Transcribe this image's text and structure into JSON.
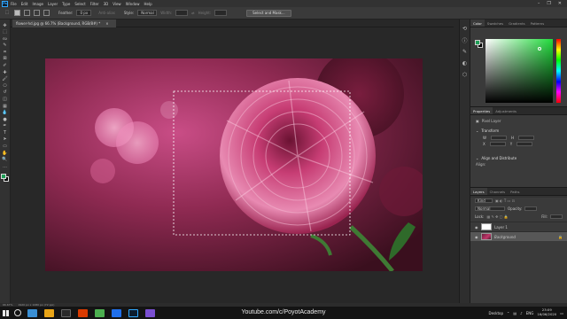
{
  "app": {
    "logo": "Ps",
    "menu": [
      "File",
      "Edit",
      "Image",
      "Layer",
      "Type",
      "Select",
      "Filter",
      "3D",
      "View",
      "Window",
      "Help"
    ],
    "window_controls": [
      "–",
      "❐",
      "✕"
    ]
  },
  "options": {
    "feather_label": "Feather:",
    "feather_value": "0 px",
    "antialias_label": "Anti-alias",
    "style_label": "Style:",
    "style_value": "Normal",
    "width_label": "Width:",
    "height_label": "Height:",
    "select_mask_button": "Select and Mask..."
  },
  "document": {
    "tab_title": "flower-hd.jpg @ 66.7% (Background, RGB/8#) *",
    "tab_close": "×"
  },
  "tools": [
    "move-icon",
    "marquee-icon",
    "lasso-icon",
    "quick-select-icon",
    "crop-icon",
    "frame-icon",
    "eyedropper-icon",
    "healing-icon",
    "brush-icon",
    "stamp-icon",
    "history-brush-icon",
    "eraser-icon",
    "gradient-icon",
    "blur-icon",
    "dodge-icon",
    "pen-icon",
    "type-icon",
    "path-select-icon",
    "shape-icon",
    "hand-icon",
    "zoom-icon",
    "more-icon"
  ],
  "tool_glyphs": [
    "✥",
    "⬚",
    "ᔓ",
    "✎",
    "⌗",
    "⊠",
    "✐",
    "✚",
    "🖌",
    "⎔",
    "↺",
    "◫",
    "▦",
    "💧",
    "●",
    "✒",
    "T",
    "➤",
    "▭",
    "✋",
    "🔍",
    "…"
  ],
  "colors": {
    "foreground": "#1f9e57",
    "background": "#000000",
    "accent": "#31a8ff"
  },
  "panels": {
    "color_tabs": [
      "Color",
      "Swatches",
      "Gradients",
      "Patterns"
    ],
    "properties_tabs": [
      "Properties",
      "Adjustments"
    ],
    "properties": {
      "pixel_layer": "Pixel Layer",
      "transform": "Transform",
      "w_label": "W",
      "h_label": "H",
      "x_label": "X",
      "y_label": "Y",
      "align": "Align and Distribute",
      "align_sub": "Align:"
    },
    "layers_tabs": [
      "Layers",
      "Channels",
      "Paths"
    ],
    "layers_controls": {
      "kind": "Kind",
      "blend": "Normal",
      "opacity": "Opacity:",
      "lock": "Lock:",
      "fill": "Fill:"
    },
    "layers": [
      {
        "name": "Layer 1",
        "thumb": "white",
        "selected": false
      },
      {
        "name": "Background",
        "thumb": "photo",
        "selected": true
      }
    ],
    "layer_footer_icons": [
      "link-icon",
      "fx-icon",
      "mask-icon",
      "adjust-icon",
      "folder-icon",
      "new-layer-icon",
      "trash-icon"
    ],
    "layer_footer_glyphs": [
      "🔗",
      "fx",
      "◙",
      "◐",
      "▭",
      "⊞",
      "🗑"
    ]
  },
  "strip_icons": [
    "history-icon",
    "info-icon",
    "brush-settings-icon",
    "adjust-panel-icon",
    "paths-panel-icon"
  ],
  "strip_glyphs": [
    "⟲",
    "ⓘ",
    "✎",
    "◐",
    "⬡"
  ],
  "status": {
    "zoom": "66.67%",
    "doc_size": "1920 px x 1080 px (72 ppi)"
  },
  "taskbar": {
    "watermark": "Youtube.com/c/PoyotAcademy",
    "desktop_label": "Desktop",
    "lang": "ENG",
    "time": "23:09",
    "date": "16/06/2020",
    "app_icon_colors": [
      "#3a8fd4",
      "#e8a417",
      "#2a2a2a",
      "#d83b01",
      "#4caf50",
      "#1f6feb",
      "#31a8ff",
      "#7a4fd1",
      "#3aa0d8",
      "#2b5797"
    ]
  }
}
